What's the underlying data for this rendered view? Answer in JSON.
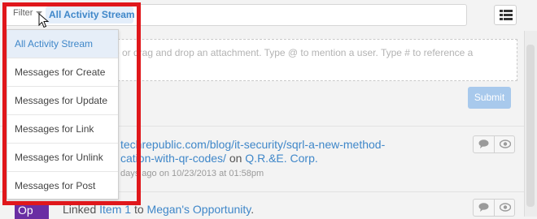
{
  "filter": {
    "label": "Filter",
    "selected": "All Activity Stream"
  },
  "composer": {
    "placeholder_visible": "e or drag and drop an attachment. Type @ to mention a user. Type # to reference a",
    "submit_label": "Submit"
  },
  "feed": {
    "item1": {
      "line1": "techrepublic.com/blog/it-security/sqrl-a-new-method-",
      "line2_link": "cation-with-qr-codes/",
      "line2_on": " on ",
      "line2_target": "Q.R.&E. Corp.",
      "meta": "days ago on 10/23/2013 at 01:58pm"
    },
    "item2": {
      "avatar": "Op",
      "prefix": "Linked ",
      "link1": "Item 1",
      "mid": " to ",
      "link2": "Megan's Opportunity",
      "suffix": "."
    }
  },
  "dropdown": {
    "items": [
      "All Activity Stream",
      "Messages for Create",
      "Messages for Update",
      "Messages for Link",
      "Messages for Unlink",
      "Messages for Post"
    ],
    "selected_index": 0
  },
  "icons": {
    "list_view": "list-view-icon",
    "comment": "comment-icon",
    "follow": "eye-icon",
    "cursor": "mouse-cursor-icon"
  },
  "colors": {
    "link": "#3f87c9",
    "highlight": "#e0171b",
    "avatar": "#6a2ea3",
    "submit": "#a8c9ec"
  }
}
